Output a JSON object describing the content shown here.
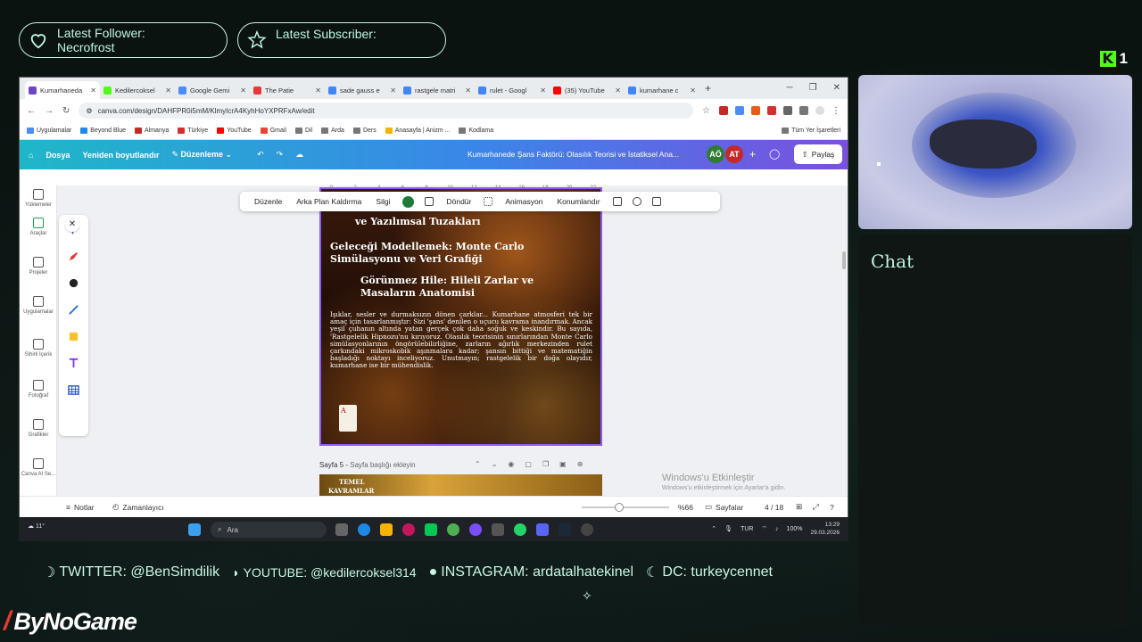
{
  "overlay": {
    "latest_follower_label": "Latest Follower:",
    "latest_follower_name": "Necrofrost",
    "latest_subscriber_label": "Latest Subscriber:",
    "viewer_count": "1",
    "chat_title": "Chat",
    "socials": {
      "twitter": "TWITTER: @BenSimdilik",
      "youtube": "YOUTUBE: @kedilercoksel314",
      "instagram": "INSTAGRAM: ardatalhatekinel",
      "discord": "DC: turkeycennet"
    },
    "brand": "ByNoGame"
  },
  "browser": {
    "tabs": [
      {
        "label": "Kumarhaneda",
        "color": "#6b46c1",
        "active": true
      },
      {
        "label": "Kedilercoksel",
        "color": "#53fc18"
      },
      {
        "label": "Google Gemi",
        "color": "#4a8df7"
      },
      {
        "label": "The Patie",
        "color": "#e53935"
      },
      {
        "label": "sade gauss e",
        "color": "#4285f4"
      },
      {
        "label": "rastgele matri",
        "color": "#4285f4"
      },
      {
        "label": "rulet - Googl",
        "color": "#4285f4"
      },
      {
        "label": "(35) YouTube",
        "color": "#ff0000"
      },
      {
        "label": "kumarhane c",
        "color": "#4285f4"
      }
    ],
    "url": "canva.com/design/DAHFPR0i5mM/KlmyIcrA4KyhHoYXPRFxAw/edit",
    "bookmarks": [
      "Uygulamalar",
      "Beyond Blue",
      "Almanya",
      "Türkiye",
      "YouTube",
      "Gmail",
      "Dil",
      "Arda",
      "Ders",
      "Anasayfa | Anizm ...",
      "Kodlama"
    ],
    "bookmarks_right": "Tüm Yer İşaretleri"
  },
  "canva": {
    "header": {
      "home_label": "Dosya",
      "resize_label": "Yeniden boyutlandır",
      "edit_label": "Düzenleme",
      "doc_title": "Kumarhanede Şans Faktörü: Olasılık Teorisi ve İstatiksel Ana...",
      "avatars": [
        "AÖ",
        "AT"
      ],
      "share_label": "Paylaş"
    },
    "sidebar": [
      "Yüklemeler",
      "Araçlar",
      "Projeler",
      "Uygulamalar",
      "Sihirli İçerik",
      "Fotoğraf",
      "Grafikler",
      "Canva AI Se..."
    ],
    "context_toolbar": [
      "Düzenle",
      "Arka Plan Kaldırma",
      "Silgi",
      "Döndür",
      "Animasyon",
      "Konumlandır"
    ],
    "ruler": [
      "0",
      "2",
      "4",
      "6",
      "8",
      "10",
      "12",
      "14",
      "16",
      "18",
      "20",
      "22"
    ],
    "page": {
      "heading_top": "ve Yazılımsal Tuzakları",
      "heading_2": "Geleceği Modellemek: Monte Carlo Simülasyonu ve Veri Grafiği",
      "heading_3": "Görünmez Hile: Hileli Zarlar ve Masaların Anatomisi",
      "body": "Işıklar, sesler ve durmaksızın dönen çarklar... Kumarhane atmosferi tek bir amaç için tasarlanmıştır: Sizi 'şans' denilen o uçucu kavrama inandırmak. Ancak yeşil çuhanın altında yatan gerçek çok daha soğuk ve keskindir. Bu sayıda, 'Rastgelelik Hipnozu'nu kırıyoruz. Olasılık teorisinin sınırlarından Monte Carlo simülasyonlarının öngörülebilirliğine, zarların ağırlık merkezinden rulet çarkındaki mikroskobik aşınmalara kadar; şansın bittiği ve matematiğin başladığı noktayı inceliyoruz. Unutmayın; rastgelelik bir doğa olayıdır, kumarhane ise bir mühendislik.",
      "card": "A"
    },
    "page5": {
      "label": "Sayfa 5 - ",
      "placeholder": "Sayfa başlığı ekleyin",
      "preview_text_1": "TEMEL",
      "preview_text_2": "KAVRAMLAR"
    },
    "watermark": {
      "title": "Windows'u Etkinleştir",
      "subtitle": "Windows'u etkinleştirmek için Ayarlar'a gidin."
    },
    "footer": {
      "notes": "Notlar",
      "timer": "Zamanlayıcı",
      "zoom": "%66",
      "pages_label": "Sayfalar",
      "page_count": "4 / 18",
      "zoom_fraction": 0.43
    }
  },
  "taskbar": {
    "search": "Ara",
    "lang": "TUR",
    "battery": "100%",
    "time": "13:29",
    "date": "29.03.2026",
    "weather": "11°"
  }
}
